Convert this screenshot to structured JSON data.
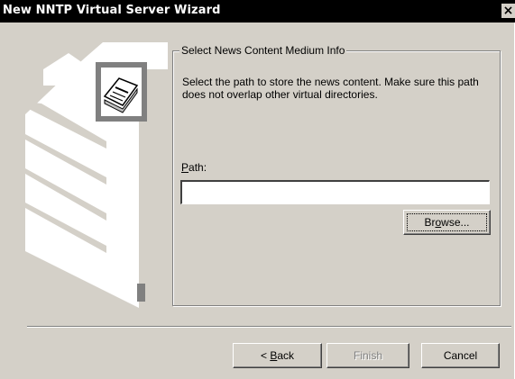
{
  "window": {
    "title": "New NNTP Virtual Server Wizard",
    "close_glyph": "×"
  },
  "image_panel": {
    "icon": "newspaper-icon"
  },
  "group": {
    "legend": "Select News Content Medium Info",
    "description": "Select the path to store the news content. Make sure this path does not overlap other virtual directories."
  },
  "path": {
    "label_accel": "P",
    "label_rest": "ath:",
    "value": ""
  },
  "buttons": {
    "browse_pre": "Br",
    "browse_accel": "o",
    "browse_post": "wse...",
    "back_pre": "< ",
    "back_accel": "B",
    "back_post": "ack",
    "finish": "Finish",
    "cancel": "Cancel"
  },
  "colors": {
    "titlebar": "#000000",
    "dialog_face": "#d4d0c8",
    "disabled_text": "#808080"
  }
}
